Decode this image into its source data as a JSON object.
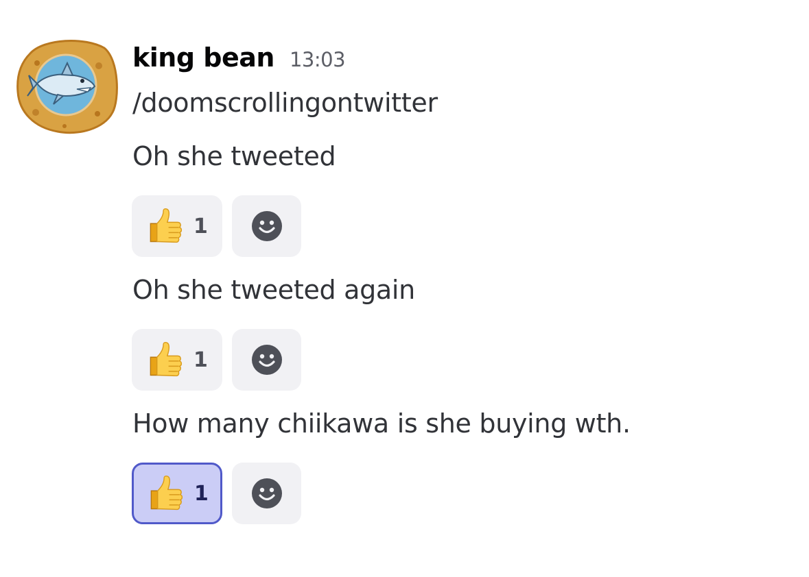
{
  "message": {
    "author": "king bean",
    "timestamp": "13:03",
    "lines": [
      {
        "text": "/doomscrollingontwitter",
        "reactions": []
      },
      {
        "text": "Oh she tweeted",
        "reactions": [
          {
            "emoji": "thumbs-up",
            "count": "1",
            "active": false
          }
        ]
      },
      {
        "text": "Oh she tweeted again",
        "reactions": [
          {
            "emoji": "thumbs-up",
            "count": "1",
            "active": false
          }
        ]
      },
      {
        "text": "How many chiikawa is she buying wth.",
        "reactions": [
          {
            "emoji": "thumbs-up",
            "count": "1",
            "active": true
          }
        ]
      }
    ]
  },
  "icons": {
    "avatar": "shark-on-cookie-avatar",
    "reaction": "thumbs-up-emoji",
    "add_reaction": "smiley-face-icon"
  },
  "colors": {
    "background": "#ffffff",
    "text": "#313338",
    "username": "#060607",
    "timestamp": "#5c5e66",
    "reaction_bg": "#f1f1f4",
    "reaction_active_bg": "#cbcdf6",
    "reaction_active_border": "#5059c9"
  }
}
